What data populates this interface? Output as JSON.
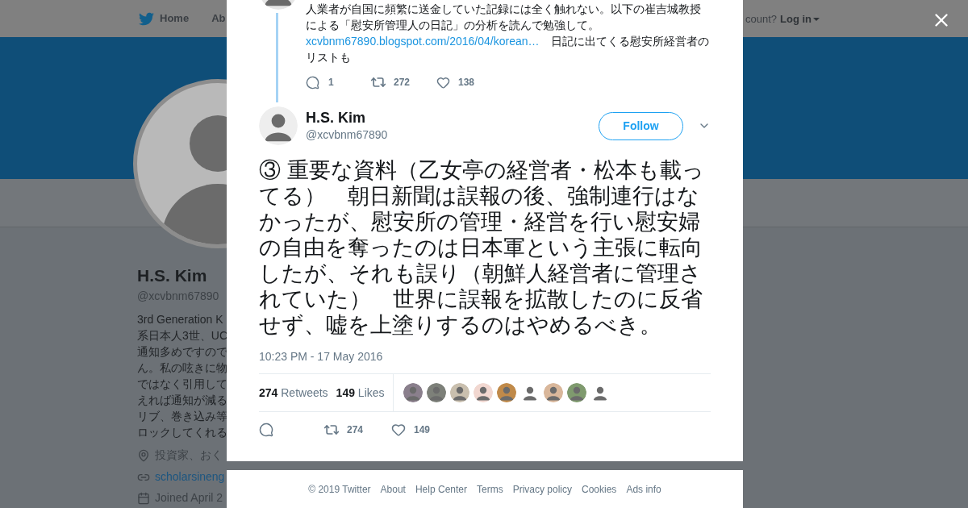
{
  "background_page": {
    "nav": {
      "items": [
        {
          "label": "Home",
          "kind": "home"
        },
        {
          "label": "Ab",
          "kind": "plain"
        }
      ],
      "login_prompt": "count?",
      "login_link": "Log in"
    },
    "profile": {
      "name": "H.S. Kim",
      "handle": "@xcvbnm67890",
      "bio_lines": [
        "3rd Generation K",
        "系日本人3世、UC",
        "通知多めですので",
        "ん。私の呟きに物",
        "ではなく引用して",
        "えれば通知が減る",
        "リブ、巻き込み等",
        "ロックしてくれる"
      ],
      "location": "投資家、おく",
      "website": "scholarsineng",
      "joined": "Joined April 2"
    }
  },
  "parent_tweet": {
    "text_before": "人業者が自国に頻繁に送金していた記録には全く触れない。以下の崔吉城教授による「慰安所管理人の日記」の分析を読んで勉強して。",
    "link": "xcvbnm67890.blogspot.com/2016/04/korean…",
    "text_after": "日記に出てくる慰安所経営者のリストも",
    "replies": "1",
    "retweets": "272",
    "likes": "138"
  },
  "tweet": {
    "name": "H.S. Kim",
    "handle": "@xcvbnm67890",
    "follow_label": "Follow",
    "text": "③ 重要な資料（乙女亭の経営者・松本も載ってる）　朝日新聞は誤報の後、強制連行はなかったが、慰安所の管理・経営を行い慰安婦の自由を奪ったのは日本軍という主張に転向したが、それも誤り（朝鮮人経営者に管理されていた）　世界に誤報を拡散したのに反省せず、嘘を上塗りするのはやめるべき。",
    "time": "10:23 PM - 17 May 2016",
    "retweets_count": "274",
    "retweets_label": "Retweets",
    "likes_count": "149",
    "likes_label": "Likes",
    "action_retweets": "274",
    "action_likes": "149"
  },
  "footer": [
    "© 2019 Twitter",
    "About",
    "Help Center",
    "Terms",
    "Privacy policy",
    "Cookies",
    "Ads info"
  ]
}
